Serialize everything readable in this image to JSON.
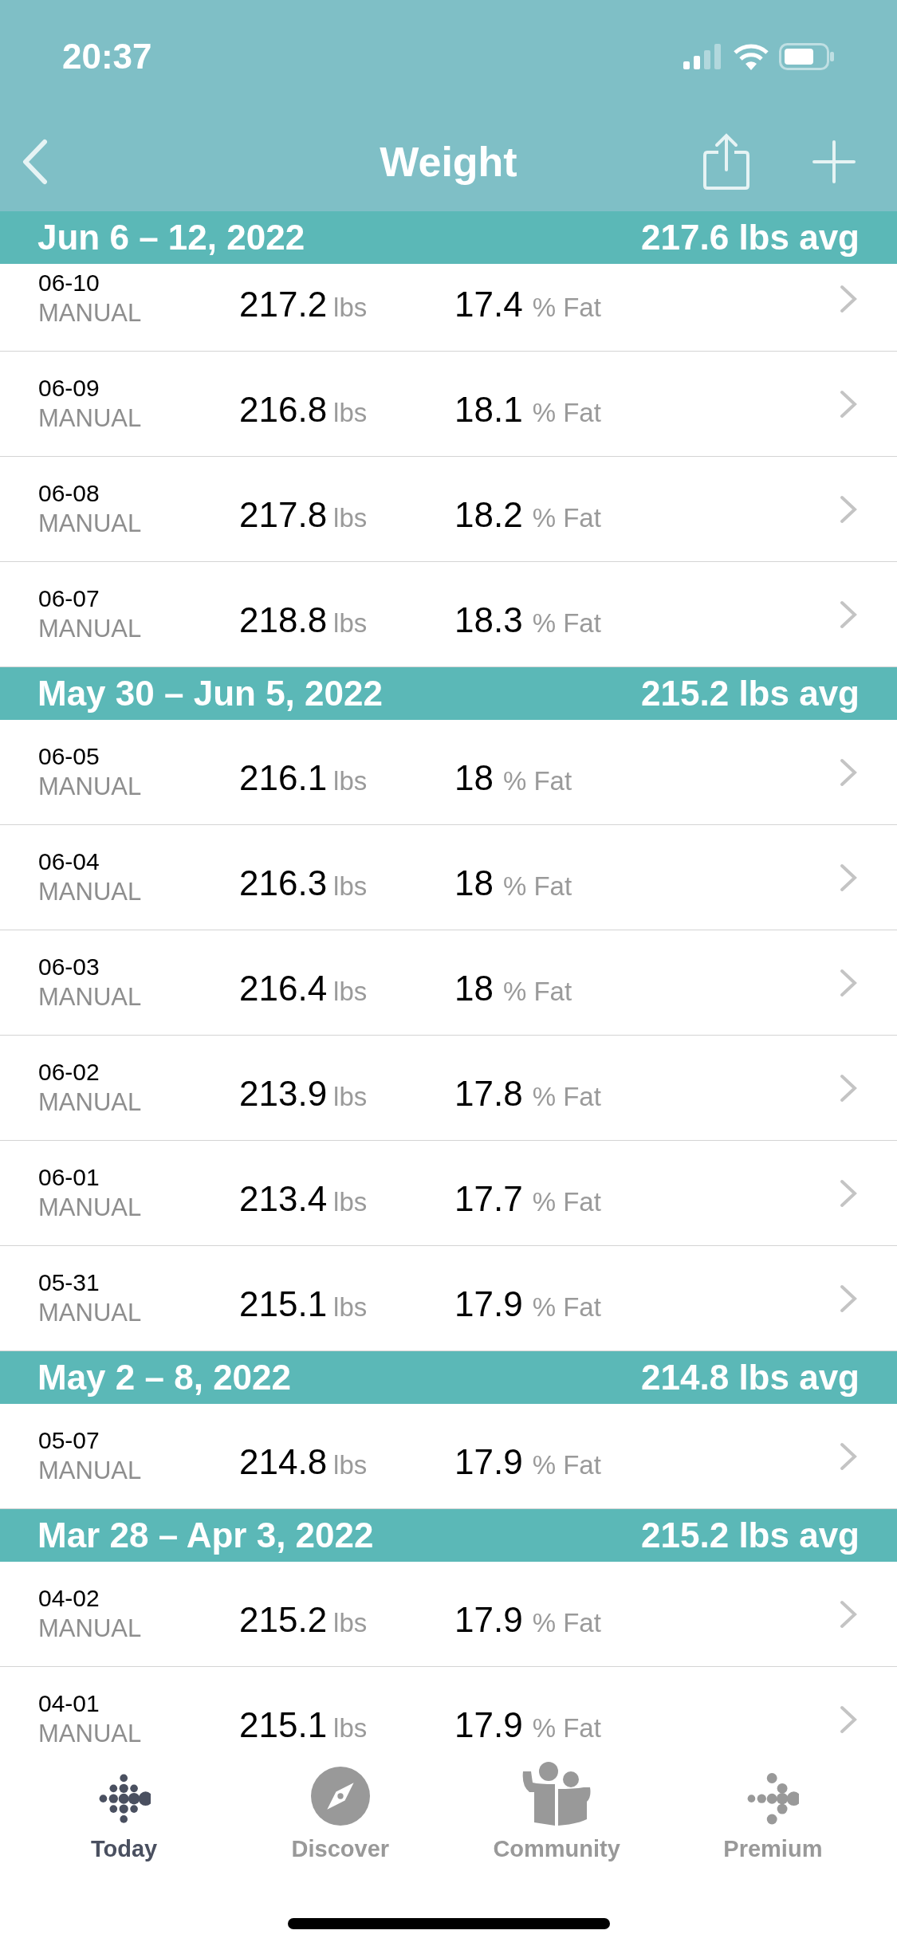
{
  "status_bar": {
    "time": "20:37"
  },
  "nav": {
    "title": "Weight"
  },
  "sections": [
    {
      "range": "Jun 6 – 12, 2022",
      "average": "217.6 lbs avg",
      "entries": [
        {
          "date": "06-10",
          "source": "MANUAL",
          "weight": "217.2",
          "weight_unit": "lbs",
          "fat": "17.4",
          "fat_unit": "% Fat"
        },
        {
          "date": "06-09",
          "source": "MANUAL",
          "weight": "216.8",
          "weight_unit": "lbs",
          "fat": "18.1",
          "fat_unit": "% Fat"
        },
        {
          "date": "06-08",
          "source": "MANUAL",
          "weight": "217.8",
          "weight_unit": "lbs",
          "fat": "18.2",
          "fat_unit": "% Fat"
        },
        {
          "date": "06-07",
          "source": "MANUAL",
          "weight": "218.8",
          "weight_unit": "lbs",
          "fat": "18.3",
          "fat_unit": "% Fat"
        }
      ]
    },
    {
      "range": "May 30 – Jun 5, 2022",
      "average": "215.2 lbs avg",
      "entries": [
        {
          "date": "06-05",
          "source": "MANUAL",
          "weight": "216.1",
          "weight_unit": "lbs",
          "fat": "18",
          "fat_unit": "% Fat"
        },
        {
          "date": "06-04",
          "source": "MANUAL",
          "weight": "216.3",
          "weight_unit": "lbs",
          "fat": "18",
          "fat_unit": "% Fat"
        },
        {
          "date": "06-03",
          "source": "MANUAL",
          "weight": "216.4",
          "weight_unit": "lbs",
          "fat": "18",
          "fat_unit": "% Fat"
        },
        {
          "date": "06-02",
          "source": "MANUAL",
          "weight": "213.9",
          "weight_unit": "lbs",
          "fat": "17.8",
          "fat_unit": "% Fat"
        },
        {
          "date": "06-01",
          "source": "MANUAL",
          "weight": "213.4",
          "weight_unit": "lbs",
          "fat": "17.7",
          "fat_unit": "% Fat"
        },
        {
          "date": "05-31",
          "source": "MANUAL",
          "weight": "215.1",
          "weight_unit": "lbs",
          "fat": "17.9",
          "fat_unit": "% Fat"
        }
      ]
    },
    {
      "range": "May 2 – 8, 2022",
      "average": "214.8 lbs avg",
      "entries": [
        {
          "date": "05-07",
          "source": "MANUAL",
          "weight": "214.8",
          "weight_unit": "lbs",
          "fat": "17.9",
          "fat_unit": "% Fat"
        }
      ]
    },
    {
      "range": "Mar 28 – Apr 3, 2022",
      "average": "215.2 lbs avg",
      "entries": [
        {
          "date": "04-02",
          "source": "MANUAL",
          "weight": "215.2",
          "weight_unit": "lbs",
          "fat": "17.9",
          "fat_unit": "% Fat"
        },
        {
          "date": "04-01",
          "source": "MANUAL",
          "weight": "215.1",
          "weight_unit": "lbs",
          "fat": "17.9",
          "fat_unit": "% Fat"
        }
      ]
    }
  ],
  "tab_bar": [
    {
      "kind": "today",
      "label": "Today",
      "selected": true
    },
    {
      "kind": "discover",
      "label": "Discover",
      "selected": false
    },
    {
      "kind": "community",
      "label": "Community",
      "selected": false
    },
    {
      "kind": "premium",
      "label": "Premium",
      "selected": false
    }
  ]
}
